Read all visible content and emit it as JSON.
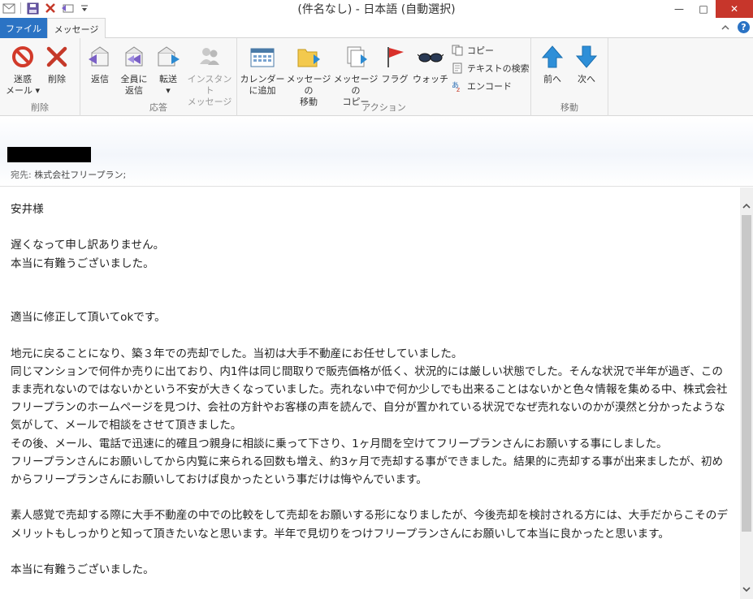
{
  "window": {
    "title": "(件名なし) - 日本語 (自動選択)",
    "controls": {
      "minimize": "—",
      "maximize": "□",
      "close": "✕"
    }
  },
  "tabs": {
    "file": "ファイル",
    "message": "メッセージ"
  },
  "ribbon": {
    "groups": {
      "delete": "削除",
      "respond": "応答",
      "actions": "アクション",
      "move": "移動"
    },
    "buttons": {
      "junk_line1": "迷惑",
      "junk_line2": "メール ▾",
      "delete": "削除",
      "reply": "返信",
      "reply_all_line1": "全員に",
      "reply_all_line2": "返信",
      "forward_line1": "転送",
      "forward_line2": "▾",
      "instant_line1": "インスタント",
      "instant_line2": "メッセージ",
      "calendar_line1": "カレンダー",
      "calendar_line2": "に追加",
      "move_msg_line1": "メッセージの",
      "move_msg_line2": "移動",
      "copy_msg_line1": "メッセージの",
      "copy_msg_line2": "コピー",
      "flag": "フラグ",
      "watch": "ウォッチ",
      "copy": "コピー",
      "find_text": "テキストの検索",
      "encode": "エンコード",
      "prev": "前へ",
      "next": "次へ"
    }
  },
  "header": {
    "to_label": "宛先:",
    "to_value": "株式会社フリープラン;"
  },
  "body": {
    "text": "安井様\n\n遅くなって申し訳ありません。\n本当に有難うございました。\n\n\n適当に修正して頂いてokです。\n\n地元に戻ることになり、築３年での売却でした。当初は大手不動産にお任せしていました。\n同じマンションで何件か売りに出ており、内1件は同じ間取りで販売価格が低く、状況的には厳しい状態でした。そんな状況で半年が過ぎ、このまま売れないのではないかという不安が大きくなっていました。売れない中で何か少しでも出来ることはないかと色々情報を集める中、株式会社フリープランのホームページを見つけ、会社の方針やお客様の声を読んで、自分が置かれている状況でなぜ売れないのかが漠然と分かったような気がして、メールで相談をさせて頂きました。\nその後、メール、電話で迅速に的確且つ親身に相談に乗って下さり、1ヶ月間を空けてフリープランさんにお願いする事にしました。\nフリープランさんにお願いしてから内覧に来られる回数も増え、約3ヶ月で売却する事ができました。結果的に売却する事が出来ましたが、初めからフリープランさんにお願いしておけば良かったという事だけは悔やんでいます。\n\n素人感覚で売却する際に大手不動産の中での比較をして売却をお願いする形になりましたが、今後売却を検討される方には、大手だからこそのデメリットもしっかりと知って頂きたいなと思います。半年で見切りをつけフリープランさんにお願いして本当に良かったと思います。\n\n本当に有難うございました。"
  },
  "colors": {
    "file_tab": "#2b73c4",
    "close_button": "#c7362b",
    "accent_blue": "#1e88d6"
  }
}
